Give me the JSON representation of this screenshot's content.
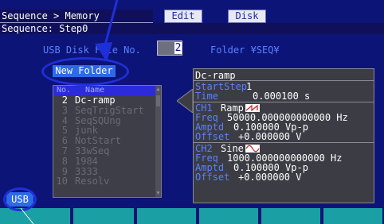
{
  "header": {
    "breadcrumb": "Sequence > Memory",
    "sequence_line": "Sequence: Step0",
    "edit_label": "Edit",
    "disk_label": "Disk"
  },
  "file": {
    "label": "USB Disk File No.",
    "number": "2",
    "folder_label": "Folder ¥SEQ¥"
  },
  "new_folder_label": "New Folder",
  "list": {
    "headers": {
      "no": "No.",
      "name": "Name"
    },
    "rows": [
      {
        "no": "2",
        "name": "Dc-ramp"
      },
      {
        "no": "3",
        "name": "SeqTrigStart"
      },
      {
        "no": "4",
        "name": "SeqSQUng"
      },
      {
        "no": "5",
        "name": "junk"
      },
      {
        "no": "6",
        "name": "NotStart"
      },
      {
        "no": "7",
        "name": "33wSeq"
      },
      {
        "no": "8",
        "name": "1984"
      },
      {
        "no": "9",
        "name": "3333"
      },
      {
        "no": "10",
        "name": "Resolv"
      }
    ]
  },
  "detail": {
    "title": "Dc-ramp",
    "start_step_key": "StartStep",
    "start_step_val": "1",
    "time_key": "Time",
    "time_val": "0.000100 s",
    "ch1": {
      "key": "CH1",
      "wave": "Ramp",
      "freq_key": "Freq",
      "freq_val": "50000.000000000000 Hz",
      "amptd_key": "Amptd",
      "amptd_val": "0.100000 Vp-p",
      "offset_key": "Offset",
      "offset_val": "+0.000000 V"
    },
    "ch2": {
      "key": "CH2",
      "wave": "Sine",
      "freq_key": "Freq",
      "freq_val": "1000.000000000000 Hz",
      "amptd_key": "Amptd",
      "amptd_val": "0.100000 Vp-p",
      "offset_key": "Offset",
      "offset_val": "+0.000000 V"
    }
  },
  "usb_label": "USB",
  "colors": {
    "screen_bg": "#0c1478",
    "accent_blue": "#2d6ae8",
    "label_blue": "#5a80ff",
    "softkey_teal": "#1aa0a4",
    "annotation_blue": "#1f2fd8"
  }
}
